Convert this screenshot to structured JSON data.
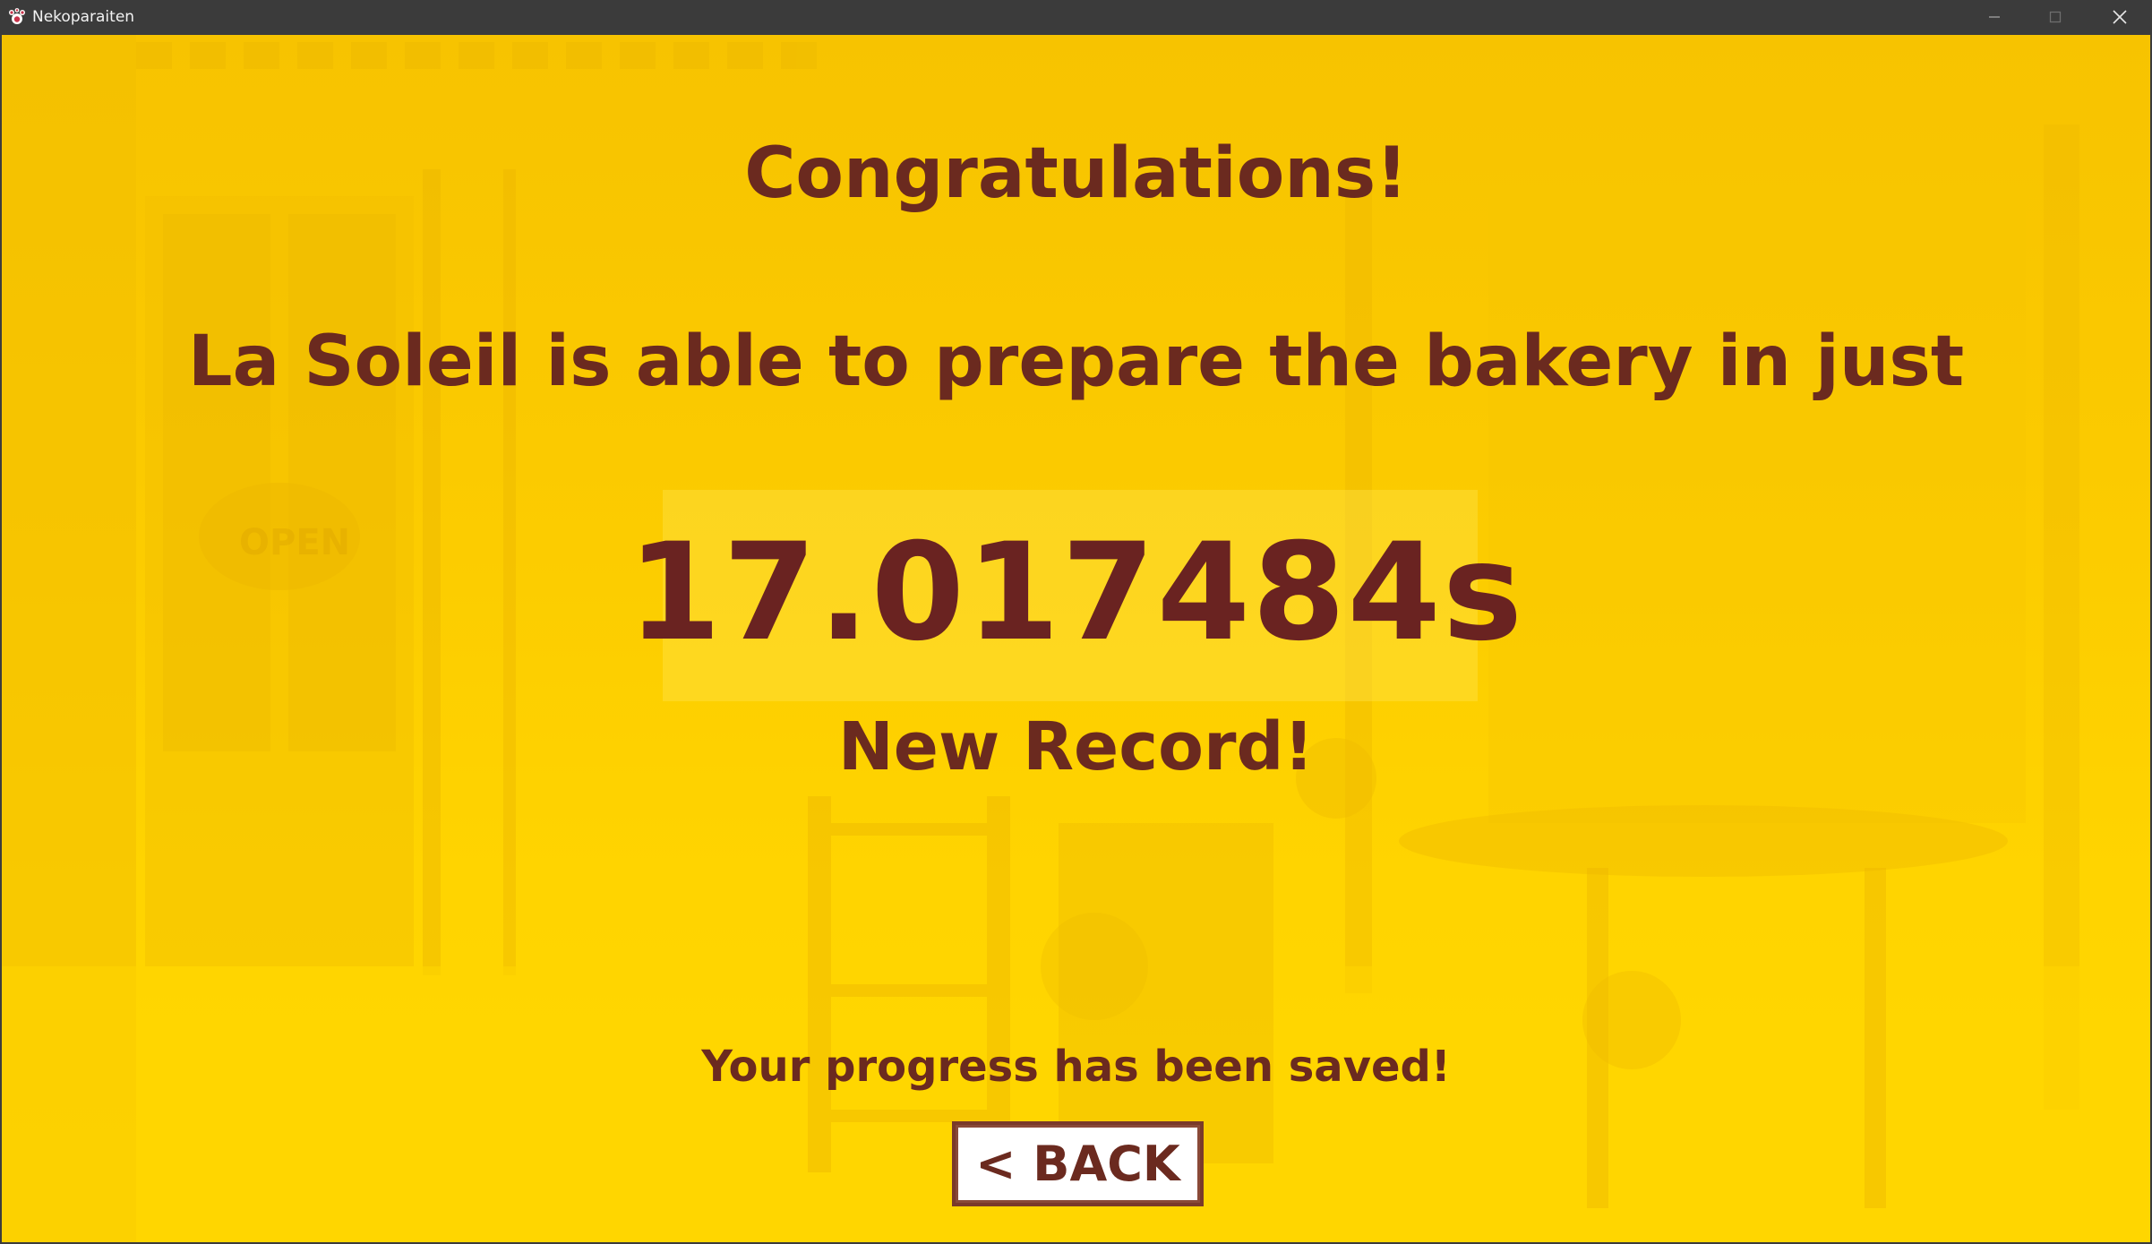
{
  "window": {
    "title": "Nekoparaiten",
    "icon": "paw-icon",
    "controls": [
      "minimize-icon",
      "maximize-icon",
      "close-icon"
    ]
  },
  "result_screen": {
    "heading": "Congratulations!",
    "message": "La Soleil is able to prepare the bakery in just",
    "time": "17.017484s",
    "record": "New Record!",
    "saved_notice": "Your progress has been saved!",
    "back_label": "< BACK"
  },
  "colors": {
    "text_brown": "#6b2a1f",
    "background_yellow": "#fbca00",
    "titlebar": "#3b3b3b"
  }
}
